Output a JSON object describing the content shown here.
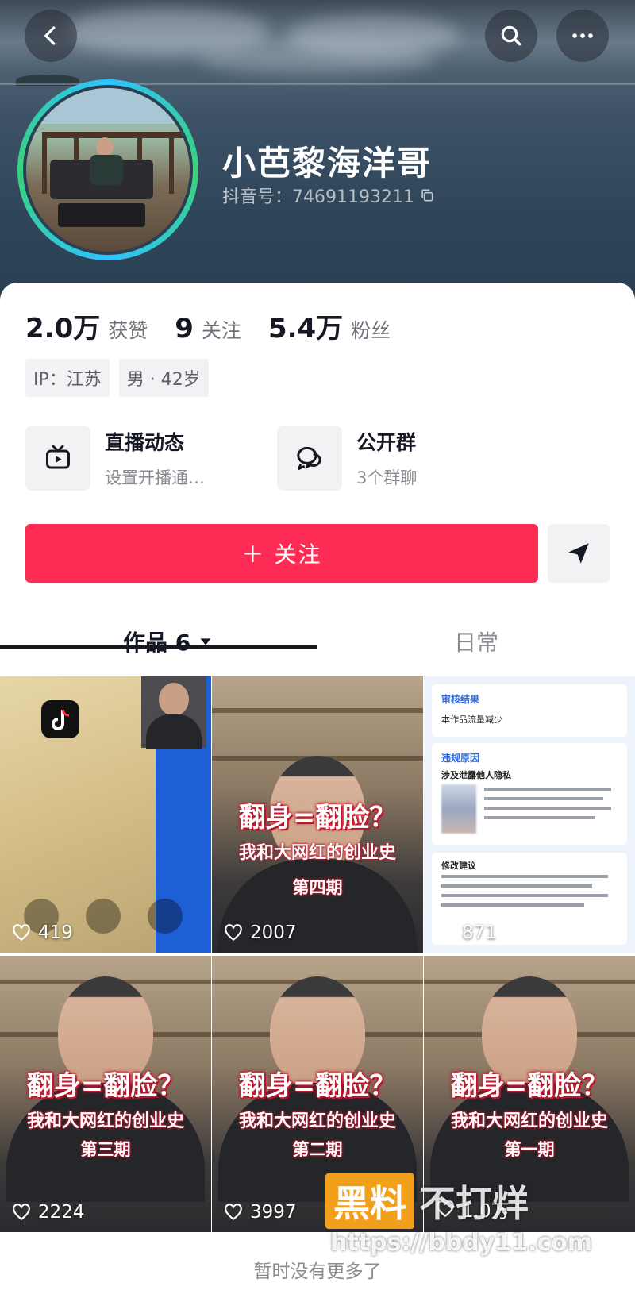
{
  "profile": {
    "nickname": "小芭黎海洋哥",
    "douyin_id": "抖音号：74691193211"
  },
  "stats": [
    {
      "value": "2.0万",
      "label": "获赞"
    },
    {
      "value": "9",
      "label": "关注"
    },
    {
      "value": "5.4万",
      "label": "粉丝"
    }
  ],
  "tags": [
    "IP：江苏",
    "男 · 42岁"
  ],
  "entries": {
    "live": {
      "title": "直播动态",
      "subtitle": "设置开播通…"
    },
    "group": {
      "title": "公开群",
      "subtitle": "3个群聊"
    }
  },
  "actions": {
    "follow_label": "＋ 关注"
  },
  "tabs": {
    "works": "作品 6",
    "daily": "日常"
  },
  "videos": [
    {
      "likes": "419"
    },
    {
      "likes": "2007",
      "overlay_title": "翻身=翻脸？",
      "overlay_subtitle": "我和大网红的创业史",
      "episode": "第四期"
    },
    {
      "likes": "871",
      "doc_title": "审核结果",
      "doc_line": "本作品流量减少",
      "doc_section": "违规原因",
      "doc_item": "涉及泄露他人隐私",
      "doc_section2": "修改建议"
    },
    {
      "likes": "2224",
      "overlay_title": "翻身=翻脸？",
      "overlay_subtitle": "我和大网红的创业史",
      "episode": "第三期"
    },
    {
      "likes": "3997",
      "overlay_title": "翻身=翻脸？",
      "overlay_subtitle": "我和大网红的创业史",
      "episode": "第二期"
    },
    {
      "likes": "1.0万",
      "overlay_title": "翻身=翻脸？",
      "overlay_subtitle": "我和大网红的创业史",
      "episode": "第一期"
    }
  ],
  "footer": {
    "no_more": "暂时没有更多了"
  },
  "watermark": {
    "badge": "黑料",
    "text": "不打烊",
    "url": "https://bbdy11.com"
  },
  "colors": {
    "accent": "#fe2c55",
    "avatar_ring_a": "#2ec3ff",
    "avatar_ring_b": "#3ad27a"
  }
}
